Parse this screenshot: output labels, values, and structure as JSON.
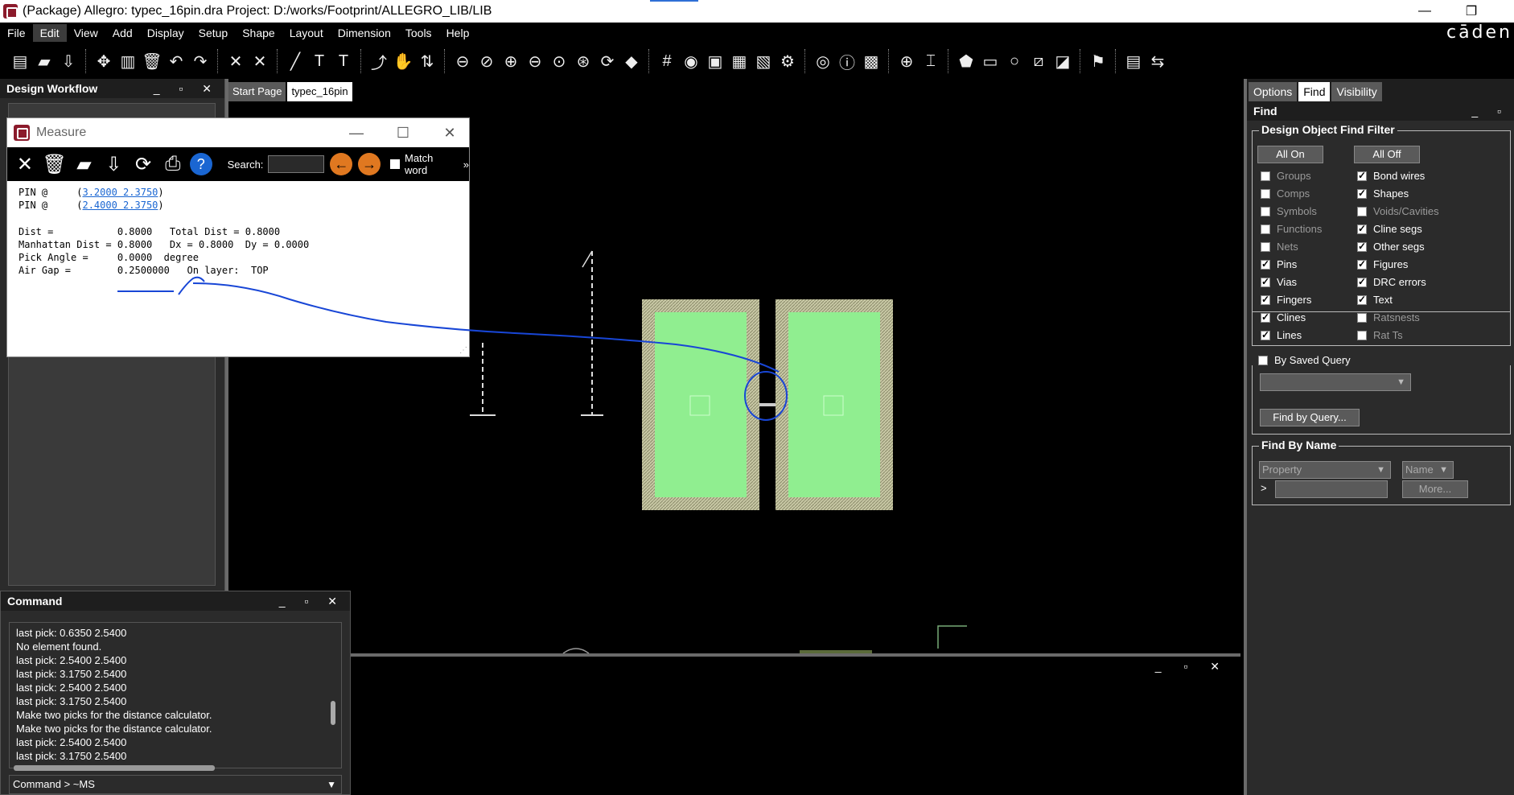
{
  "window": {
    "title": "(Package) Allegro: typec_16pin.dra  Project: D:/works/Footprint/ALLEGRO_LIB/LIB",
    "brand": "cāden",
    "minimize": "—",
    "restore": "❐"
  },
  "menu": [
    "File",
    "Edit",
    "View",
    "Add",
    "Display",
    "Setup",
    "Shape",
    "Layout",
    "Dimension",
    "Tools",
    "Help"
  ],
  "toolbar_icons": [
    "new-icon",
    "open-icon",
    "save-icon",
    "move-icon",
    "copy-icon",
    "delete-icon",
    "undo-icon",
    "redo-icon",
    "pin-icon",
    "unpin-icon",
    "add-line-icon",
    "text-icon",
    "text-edit-icon",
    "route-icon",
    "slide-icon",
    "spread-icon",
    "zoom-fit-icon",
    "zoom-window-icon",
    "zoom-in-icon",
    "zoom-out-icon",
    "zoom-world-icon",
    "zoom-center-icon",
    "redraw-icon",
    "shape-icon",
    "grid-icon",
    "color-icon",
    "layer-icon",
    "visibility-icon",
    "report-icon",
    "settings-icon",
    "view-icon",
    "info-icon",
    "3d-icon",
    "place-icon",
    "measure-icon",
    "add-shape-icon",
    "add-text-icon",
    "add-circle-icon",
    "edit-icon",
    "dimension-icon",
    "camera-icon",
    "export-icon",
    "tools-icon"
  ],
  "left_panel": {
    "title": "Design Workflow",
    "buttons": "_ ▫ ✕"
  },
  "doc_tabs": [
    "Start Page",
    "typec_16pin"
  ],
  "measure": {
    "title": "Measure",
    "search_label": "Search:",
    "match_word": "Match word",
    "more": "»",
    "lines": {
      "pin1_prefix": "PIN @     (",
      "pin1_coord": "3.2000 2.3750",
      "pin2_prefix": "PIN @     (",
      "pin2_coord": "2.4000 2.3750",
      "dist": "Dist =           0.8000   Total Dist = 0.8000",
      "manhattan": "Manhattan Dist = 0.8000   Dx = 0.8000  Dy = 0.0000",
      "angle": "Pick Angle =     0.0000  degree",
      "airgap": "Air Gap =        0.2500000   On layer:  TOP"
    }
  },
  "command": {
    "title": "Command",
    "buttons": "_ ▫ ✕",
    "log": [
      "last pick:  0.6350 2.5400",
      "No element found.",
      "last pick:  2.5400 2.5400",
      "last pick:  3.1750 2.5400",
      "last pick:  2.5400 2.5400",
      "last pick:  3.1750 2.5400",
      "Make two picks for the distance calculator.",
      "Make two picks for the distance calculator.",
      "last pick:  2.5400 2.5400",
      "last pick:  3.1750 2.5400"
    ],
    "prompt": "Command >        ~MS"
  },
  "bottom_panel": {
    "buttons": "_ ▫ ✕"
  },
  "right_panel": {
    "tabs": [
      "Options",
      "Find",
      "Visibility"
    ],
    "header": "Find",
    "buttons": "_ ▫",
    "filter_title": "Design Object Find Filter",
    "all_on": "All On",
    "all_off": "All Off",
    "left_items": [
      {
        "label": "Groups",
        "checked": false
      },
      {
        "label": "Comps",
        "checked": false
      },
      {
        "label": "Symbols",
        "checked": false
      },
      {
        "label": "Functions",
        "checked": false
      },
      {
        "label": "Nets",
        "checked": false
      },
      {
        "label": "Pins",
        "checked": true
      },
      {
        "label": "Vias",
        "checked": true
      },
      {
        "label": "Fingers",
        "checked": true
      },
      {
        "label": "Clines",
        "checked": true
      },
      {
        "label": "Lines",
        "checked": true
      }
    ],
    "right_items": [
      {
        "label": "Bond wires",
        "checked": true
      },
      {
        "label": "Shapes",
        "checked": true
      },
      {
        "label": "Voids/Cavities",
        "checked": false
      },
      {
        "label": "Cline segs",
        "checked": true
      },
      {
        "label": "Other segs",
        "checked": true
      },
      {
        "label": "Figures",
        "checked": true
      },
      {
        "label": "DRC errors",
        "checked": true
      },
      {
        "label": "Text",
        "checked": true
      },
      {
        "label": "Ratsnests",
        "checked": false
      },
      {
        "label": "Rat Ts",
        "checked": false
      }
    ],
    "saved_query": "By Saved Query",
    "find_by_query": "Find by Query...",
    "find_by_name_title": "Find By Name",
    "property": "Property",
    "name": "Name",
    "prompt": ">",
    "more": "More..."
  },
  "colors": {
    "pad_fill": "#90ee90",
    "pad_border": "#c9c9a6",
    "annotation": "#1846d6"
  }
}
